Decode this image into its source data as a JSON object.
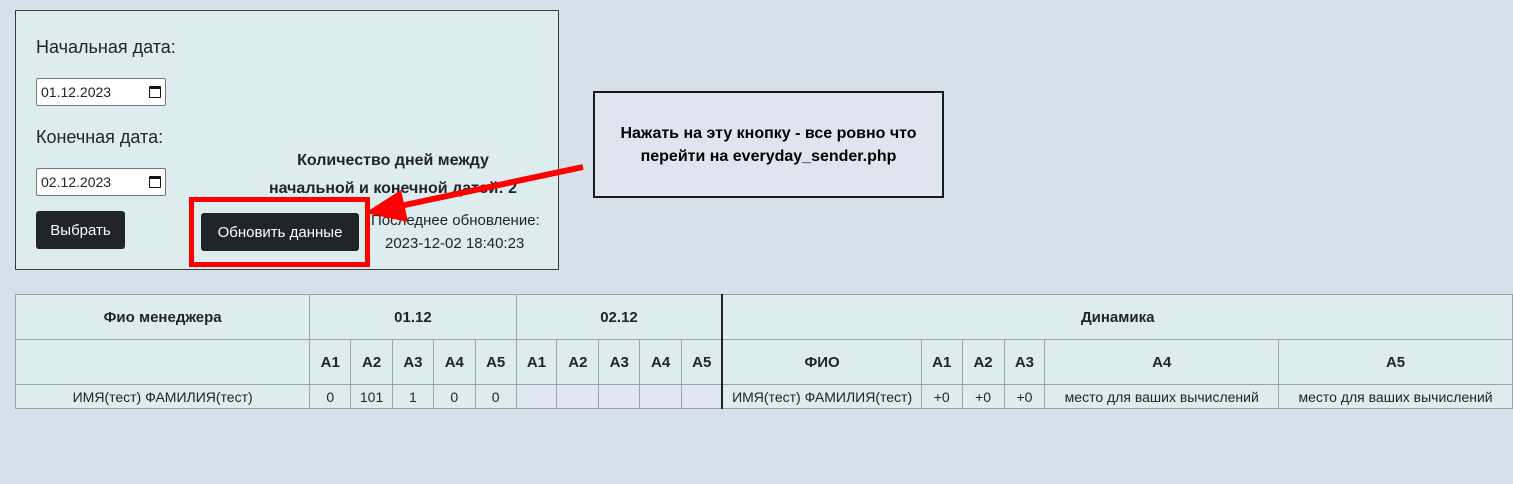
{
  "filters": {
    "start_label": "Начальная дата:",
    "start_value": "01.12.2023",
    "end_label": "Конечная дата:",
    "end_value": "02.12.2023",
    "select_button": "Выбрать",
    "days_line1": "Количество дней между",
    "days_line2": "начальной и конечной датой: 2",
    "refresh_button": "Обновить данные",
    "last_update_label": "Последнее обновление:",
    "last_update_value": "2023-12-02 18:40:23"
  },
  "callout": {
    "text": "Нажать на эту кнопку - все ровно что перейти на everyday_sender.php"
  },
  "annotation_color": "#ff0000",
  "table": {
    "head": {
      "manager": "Фио менеджера",
      "date1": "01.12",
      "date2": "02.12",
      "dynamics": "Динамика"
    },
    "sub": {
      "cols": [
        "A1",
        "A2",
        "A3",
        "A4",
        "A5"
      ],
      "fio": "ФИО",
      "dyn_cols": [
        "A1",
        "A2",
        "A3",
        "A4",
        "A5"
      ]
    },
    "row": {
      "name": "ИМЯ(тест) ФАМИЛИЯ(тест)",
      "d1": [
        "0",
        "101",
        "1",
        "0",
        "0"
      ],
      "d2": [
        "",
        "",
        "",
        "",
        ""
      ],
      "dyn_name": "ИМЯ(тест) ФАМИЛИЯ(тест)",
      "dyn": [
        "+0",
        "+0",
        "+0",
        "место для ваших вычислений",
        "место для ваших вычислений"
      ]
    }
  }
}
